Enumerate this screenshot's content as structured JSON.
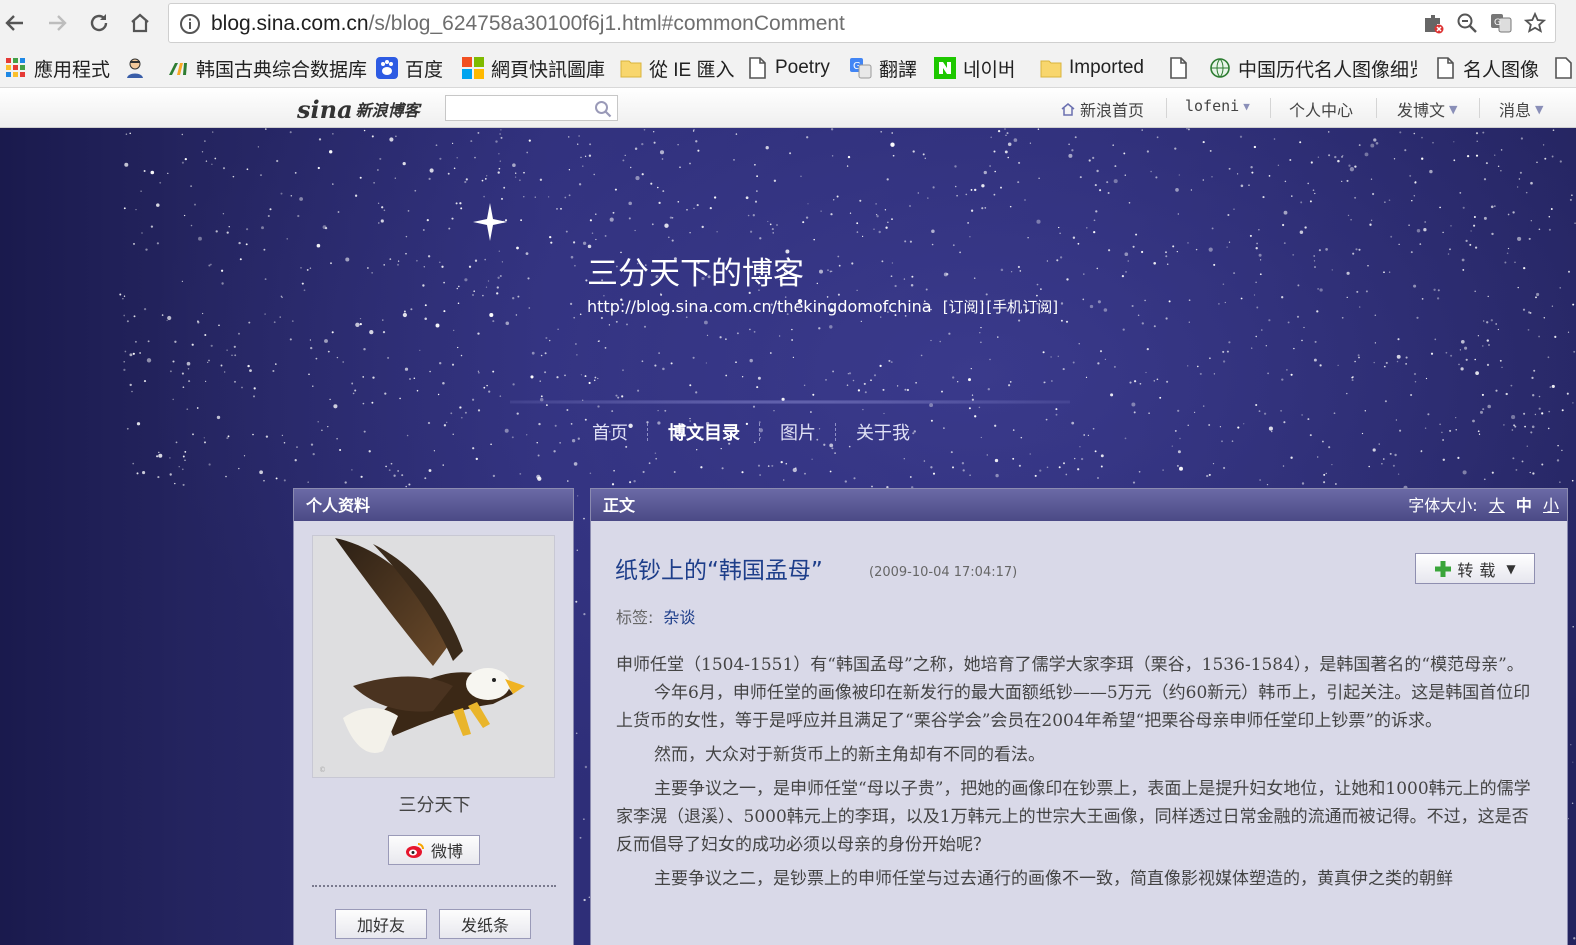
{
  "browser": {
    "url_host": "blog.sina.com.cn",
    "url_path": "/s/blog_624758a30100f6j1.html#commonComment",
    "bookmarks": [
      {
        "label": "應用程式",
        "icon": "apps-grid-icon"
      },
      {
        "label": "",
        "icon": "profile-avatar-icon"
      },
      {
        "label": "韩国古典综合数据库",
        "icon": "database-icon"
      },
      {
        "label": "百度",
        "icon": "baidu-paw-icon"
      },
      {
        "label": "網頁快訊圖庫",
        "icon": "windows-logo-icon"
      },
      {
        "label": "從 IE 匯入",
        "icon": "folder-icon"
      },
      {
        "label": "Poetry",
        "icon": "page-icon"
      },
      {
        "label": "翻譯",
        "icon": "translate-icon"
      },
      {
        "label": "네이버",
        "icon": "naver-icon"
      },
      {
        "label": "Imported",
        "icon": "folder-icon"
      },
      {
        "label": "",
        "icon": "page-icon"
      },
      {
        "label": "中国历代名人图像细览",
        "icon": "globe-icon"
      },
      {
        "label": "名人图像",
        "icon": "page-icon"
      }
    ]
  },
  "sina_bar": {
    "logo_sina": "sina",
    "logo_blog": "新浪博客",
    "nav": [
      {
        "label": "新浪首页",
        "icon": "home-icon",
        "dropdown": false
      },
      {
        "label": "lofeni",
        "dropdown": true
      },
      {
        "label": "个人中心",
        "dropdown": false
      },
      {
        "label": "发博文",
        "dropdown": true
      },
      {
        "label": "消息",
        "dropdown": true
      }
    ]
  },
  "blog": {
    "title": "三分天下的博客",
    "url": "http://blog.sina.com.cn/thekingdomofchina",
    "subscribe": "[订阅]",
    "mobile_subscribe": "[手机订阅]",
    "nav": [
      "首页",
      "博文目录",
      "图片",
      "关于我"
    ],
    "nav_active": "博文目录"
  },
  "profile": {
    "heading": "个人资料",
    "name": "三分天下",
    "weibo_label": "微博",
    "add_friend": "加好友",
    "send_note": "发纸条",
    "avatar_caption": "eagle-image"
  },
  "article": {
    "heading": "正文",
    "font_size_label": "字体大小:",
    "font_sizes": [
      "大",
      "中",
      "小"
    ],
    "font_size_current": "中",
    "title": "纸钞上的“韩国孟母”",
    "time": "(2009-10-04 17:04:17)",
    "repost_label": "转载",
    "tags_label": "标签:",
    "tags": [
      "杂谈"
    ],
    "paragraphs": [
      "申师任堂（1504-1551）有“韩国孟母”之称，她培育了儒学大家李珥（栗谷，1536-1584），是韩国著名的“模范母亲”。",
      "今年6月，申师任堂的画像被印在新发行的最大面额纸钞——5万元（约60新元）韩币上，引起关注。这是韩国首位印上货币的女性，等于是呼应并且满足了“栗谷学会”会员在2004年希望“把栗谷母亲申师任堂印上钞票”的诉求。",
      "然而，大众对于新货币上的新主角却有不同的看法。",
      "主要争议之一，是申师任堂“母以子贵”，把她的画像印在钞票上，表面上是提升妇女地位，让她和1000韩元上的儒学家李滉（退溪）、5000韩元上的李珥，以及1万韩元上的世宗大王画像，同样透过日常金融的流通而被记得。不过，这是否反而倡导了妇女的成功必须以母亲的身份开始呢？",
      "主要争议之二，是钞票上的申师任堂与过去通行的画像不一致，简直像影视媒体塑造的，黄真伊之类的朝鲜"
    ]
  },
  "colors": {
    "sky": "#2a2a70",
    "panel": "#d9d9e8",
    "panel_head": "#5c5b98",
    "link": "#1e3e8a"
  }
}
